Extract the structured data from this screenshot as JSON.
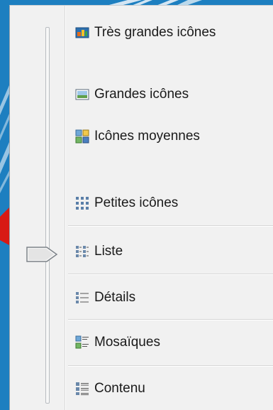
{
  "menu": {
    "items": [
      {
        "label": "Très grandes icônes",
        "icon": "extra-large-icons-icon"
      },
      {
        "label": "Grandes icônes",
        "icon": "large-icons-icon"
      },
      {
        "label": "Icônes moyennes",
        "icon": "medium-icons-icon"
      },
      {
        "label": "Petites icônes",
        "icon": "small-icons-icon"
      },
      {
        "label": "Liste",
        "icon": "list-view-icon"
      },
      {
        "label": "Détails",
        "icon": "details-view-icon"
      },
      {
        "label": "Mosaïques",
        "icon": "tiles-view-icon"
      },
      {
        "label": "Contenu",
        "icon": "content-view-icon"
      }
    ],
    "selected_view": "Liste"
  },
  "colors": {
    "background": "#1d7fc0",
    "menu_background": "#f1f1f1",
    "pointer_arrow": "#e0201a"
  }
}
